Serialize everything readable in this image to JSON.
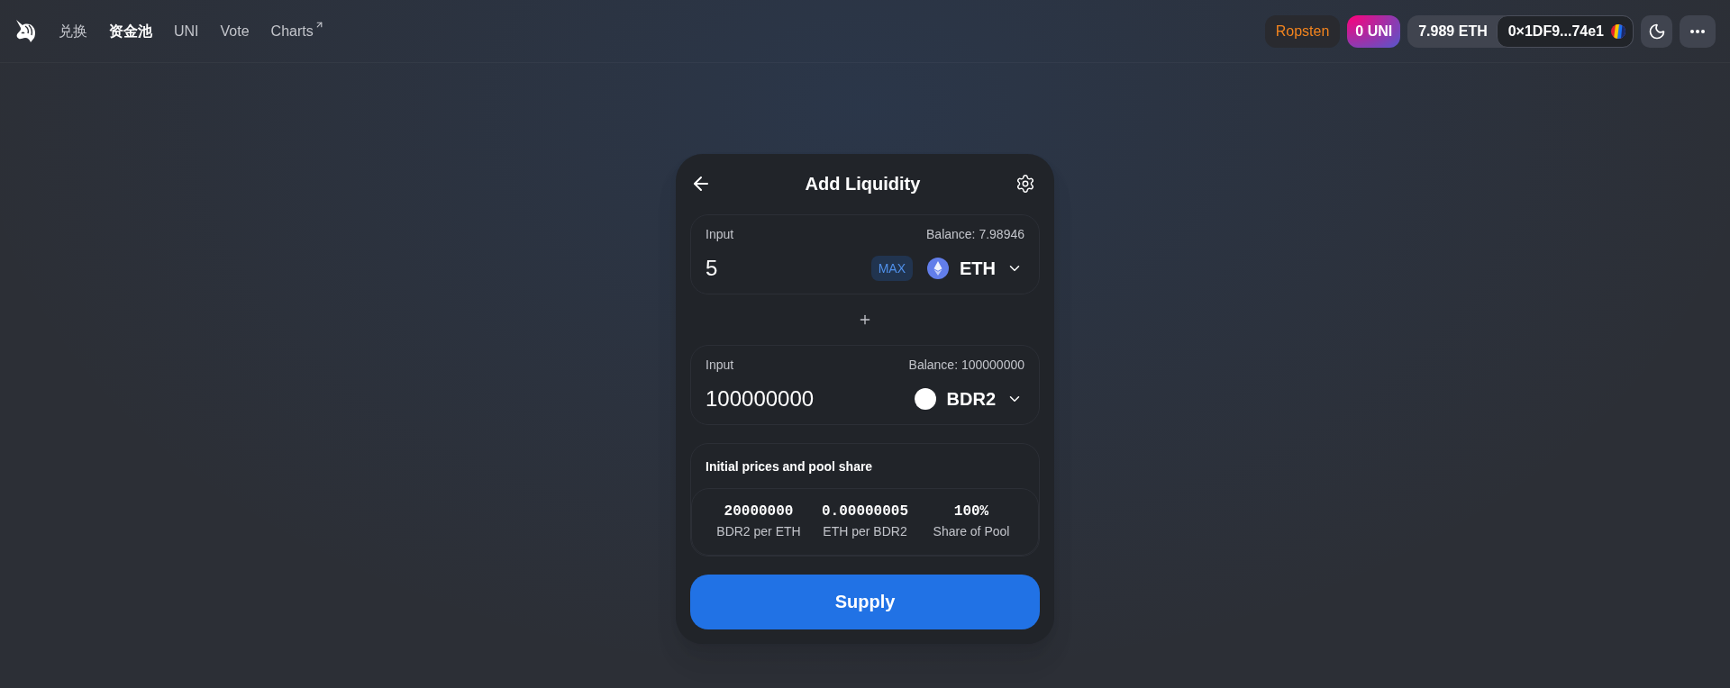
{
  "header": {
    "nav": [
      {
        "label": "兑换",
        "selected": false,
        "external": false
      },
      {
        "label": "资金池",
        "selected": true,
        "external": false
      },
      {
        "label": "UNI",
        "selected": false,
        "external": false
      },
      {
        "label": "Vote",
        "selected": false,
        "external": false
      },
      {
        "label": "Charts",
        "selected": false,
        "external": true
      }
    ],
    "network": "Ropsten",
    "uni_balance": "0 UNI",
    "eth_balance": "7.989 ETH",
    "address": "0×1DF9...74e1"
  },
  "card": {
    "title": "Add Liquidity",
    "inputs": [
      {
        "label": "Input",
        "balance": "Balance: 7.98946",
        "value": "5",
        "max_button": "MAX",
        "token": {
          "symbol": "ETH",
          "kind": "eth"
        }
      },
      {
        "label": "Input",
        "balance": "Balance: 100000000",
        "value": "100000000",
        "token": {
          "symbol": "BDR2",
          "kind": "unknown"
        }
      }
    ],
    "pool_share": {
      "title": "Initial prices and pool share",
      "stats": [
        {
          "value": "20000000",
          "label": "BDR2 per ETH"
        },
        {
          "value": "0.00000005",
          "label": "ETH per BDR2"
        },
        {
          "value": "100%",
          "label": "Share of Pool"
        }
      ]
    },
    "submit_button": "Supply"
  }
}
